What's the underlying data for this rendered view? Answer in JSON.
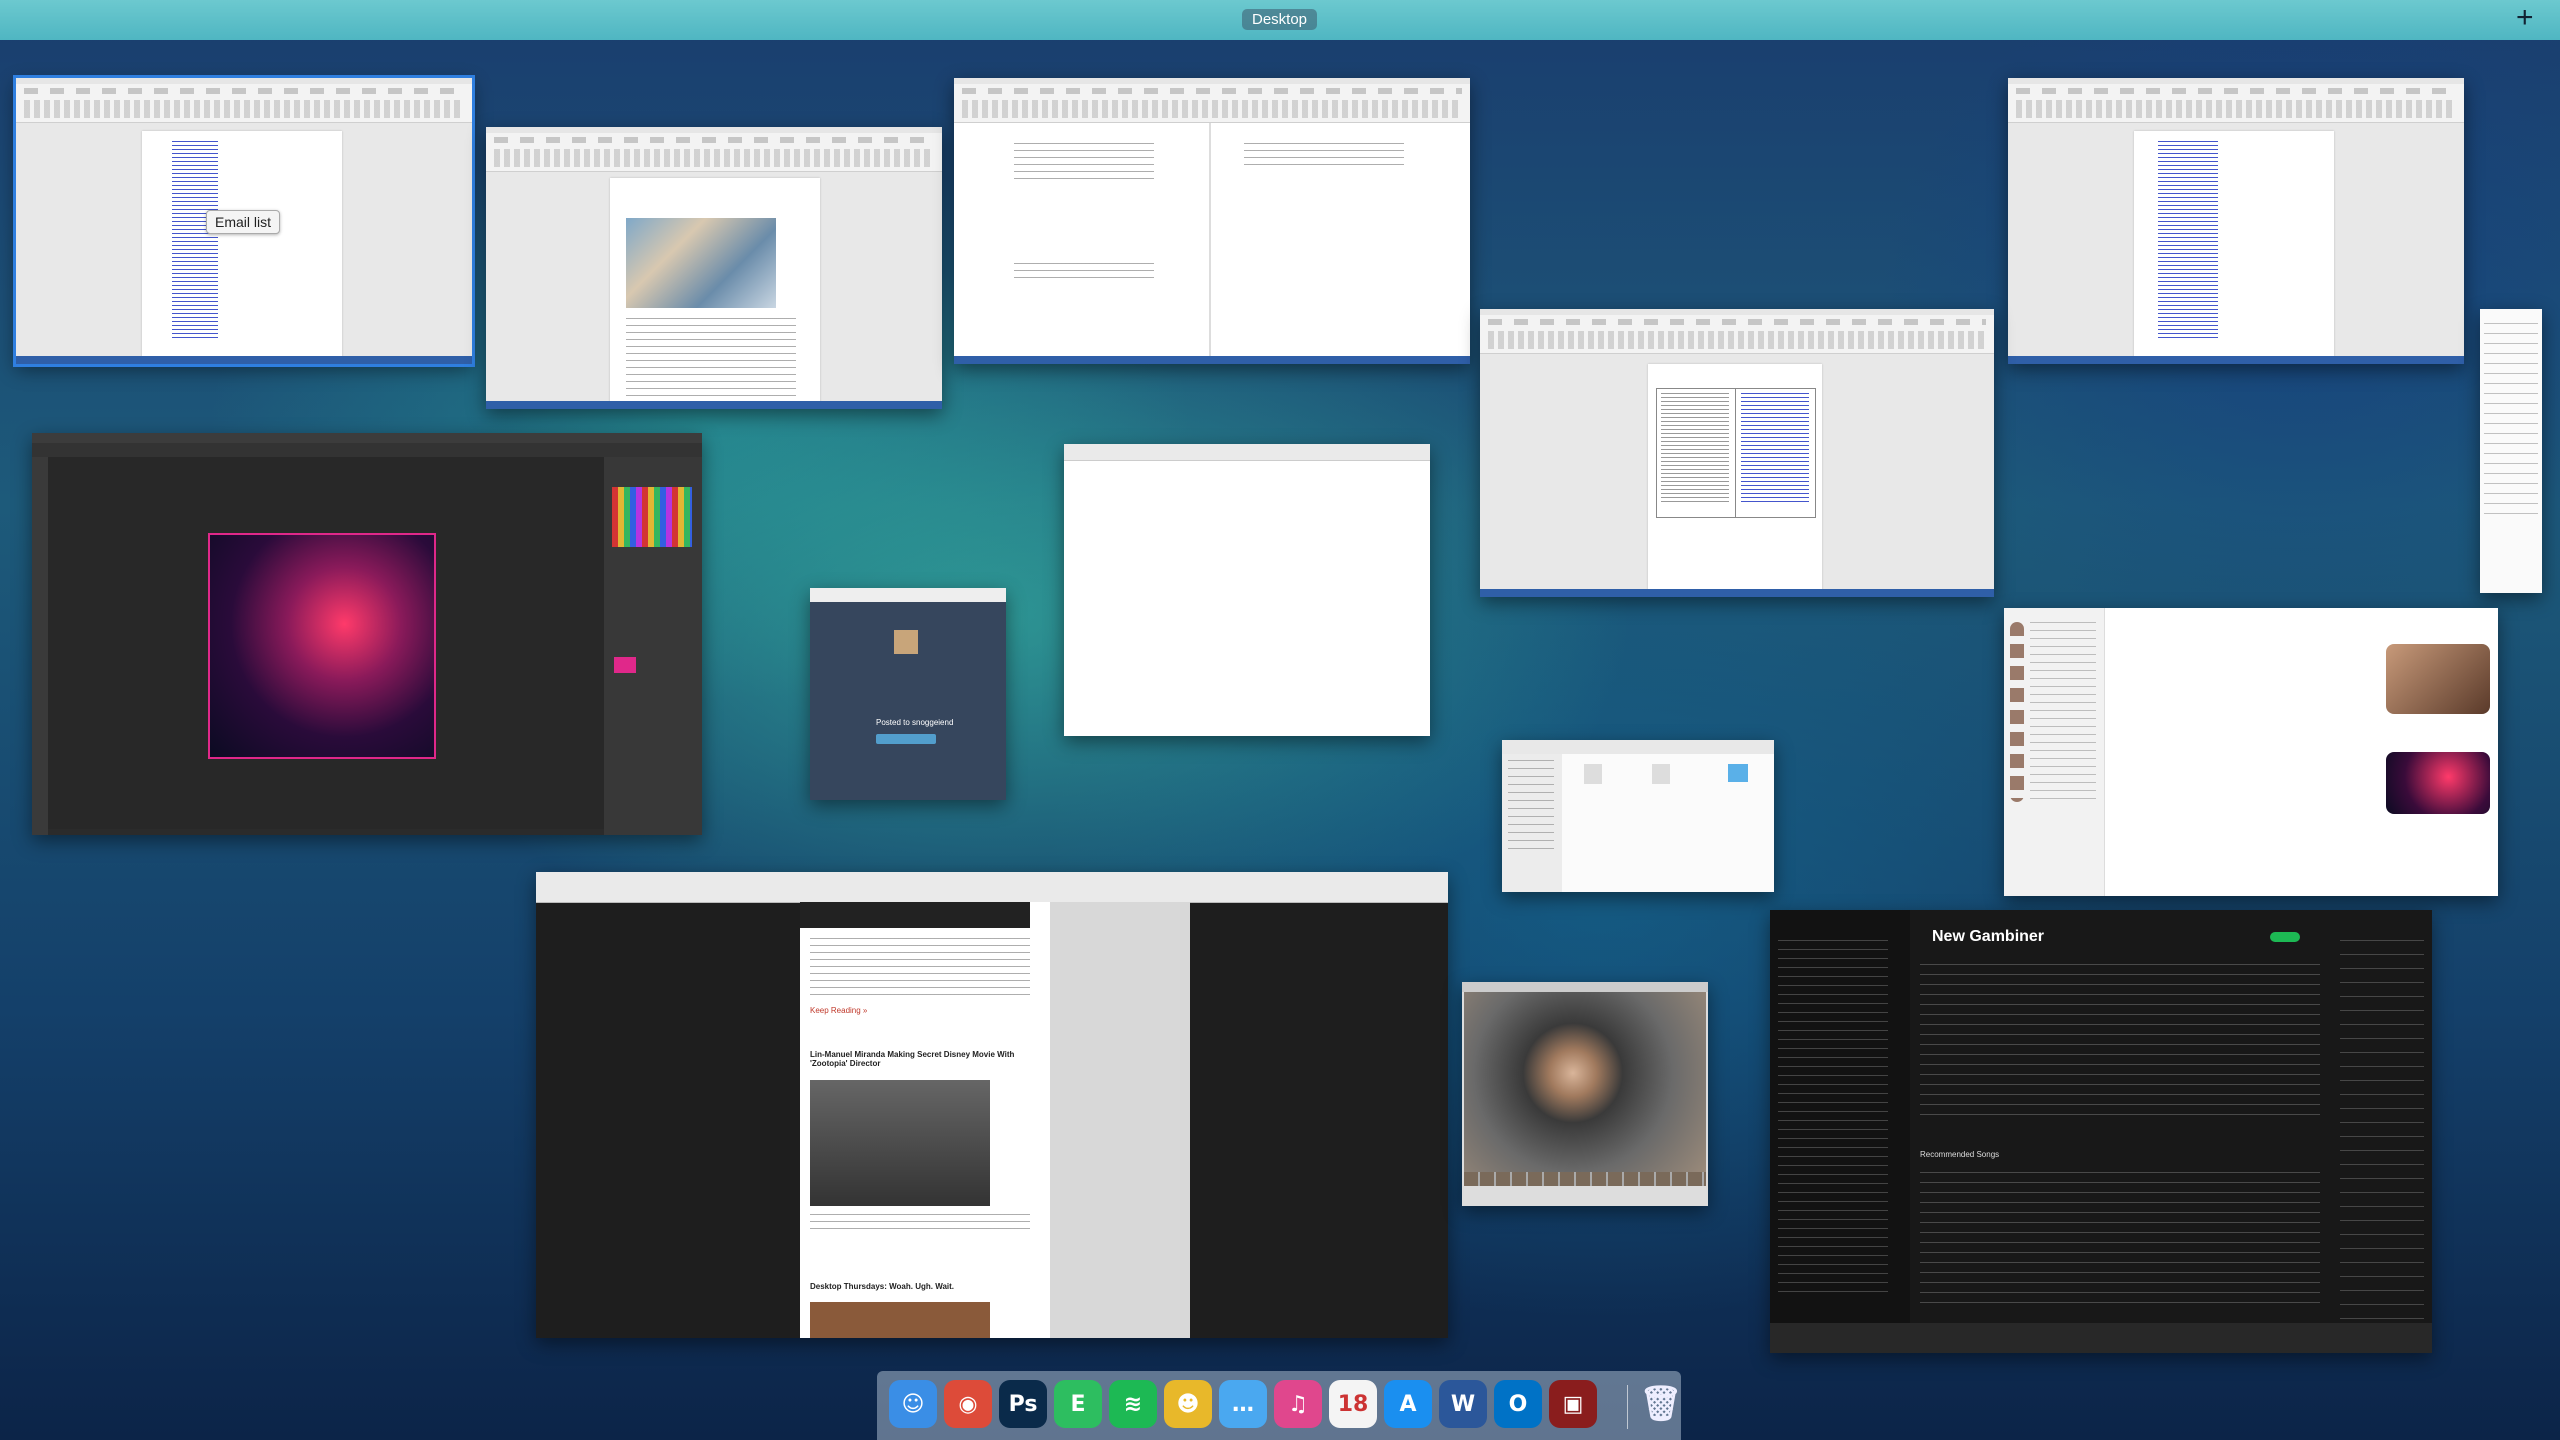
{
  "spaces_bar": {
    "label": "Desktop",
    "add_label": "+"
  },
  "tooltip": {
    "label": "Email list"
  },
  "browser_blog": {
    "headline_1": "Lin-Manuel Miranda Making Secret Disney Movie With 'Zootopia' Director",
    "headline_2": "Desktop Thursdays: Woah. Ugh. Wait.",
    "keep_reading": "Keep Reading »"
  },
  "tumblr": {
    "message": "Posted to snoggeiend"
  },
  "spotify": {
    "playlist_title": "New Gambiner",
    "section": "Recommended Songs"
  },
  "dock": {
    "apps": [
      {
        "name": "finder-icon",
        "glyph": "☺",
        "color": "#3a8ee6"
      },
      {
        "name": "chrome-icon",
        "glyph": "◉",
        "color": "#dd4b39"
      },
      {
        "name": "photoshop-icon",
        "glyph": "Ps",
        "color": "#0a2a4a"
      },
      {
        "name": "evernote-icon",
        "glyph": "E",
        "color": "#2dbe60"
      },
      {
        "name": "spotify-icon",
        "glyph": "≋",
        "color": "#1db954"
      },
      {
        "name": "adium-icon",
        "glyph": "☻",
        "color": "#e8b82a"
      },
      {
        "name": "messages-icon",
        "glyph": "…",
        "color": "#4aa8f0"
      },
      {
        "name": "itunes-icon",
        "glyph": "♫",
        "color": "#e0478d"
      },
      {
        "name": "calendar-icon",
        "glyph": "18",
        "color": "#f4f4f4"
      },
      {
        "name": "app-store-icon",
        "glyph": "A",
        "color": "#1a8ff0"
      },
      {
        "name": "word-icon",
        "glyph": "W",
        "color": "#2b579a"
      },
      {
        "name": "outlook-icon",
        "glyph": "O",
        "color": "#0072c6"
      },
      {
        "name": "photo-booth-icon",
        "glyph": "▣",
        "color": "#8a1d1d"
      }
    ],
    "trash": {
      "name": "trash-icon",
      "glyph": "🗑"
    }
  }
}
